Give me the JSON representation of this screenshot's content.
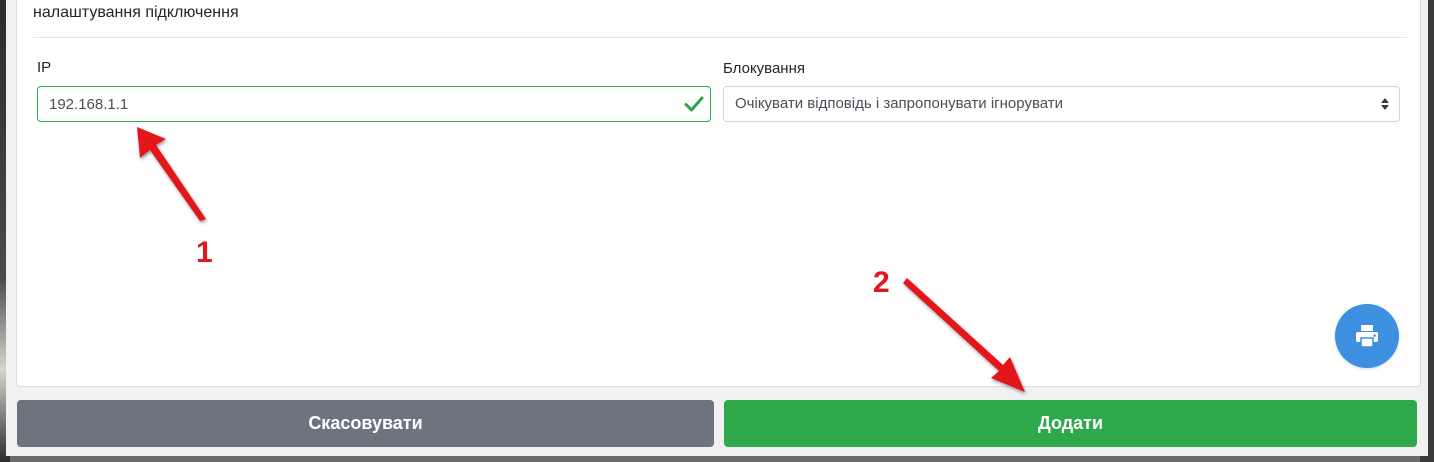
{
  "panel": {
    "title": "налаштування підключення"
  },
  "form": {
    "ip_label": "IP",
    "ip_value": "192.168.1.1",
    "blocking_label": "Блокування",
    "blocking_selected": "Очікувати відповідь і запропонувати ігнорувати"
  },
  "buttons": {
    "cancel_label": "Скасовувати",
    "add_label": "Додати"
  },
  "annotations": {
    "marker_1": "1",
    "marker_2": "2"
  },
  "icons": {
    "valid": "check-icon",
    "select": "select-caret-icon",
    "fab": "printer-icon"
  },
  "colors": {
    "success": "#28a745",
    "primary_fab": "#3d8fe0",
    "cancel": "#6c757d",
    "add": "#2ea84b",
    "annotation": "#e3161c"
  }
}
